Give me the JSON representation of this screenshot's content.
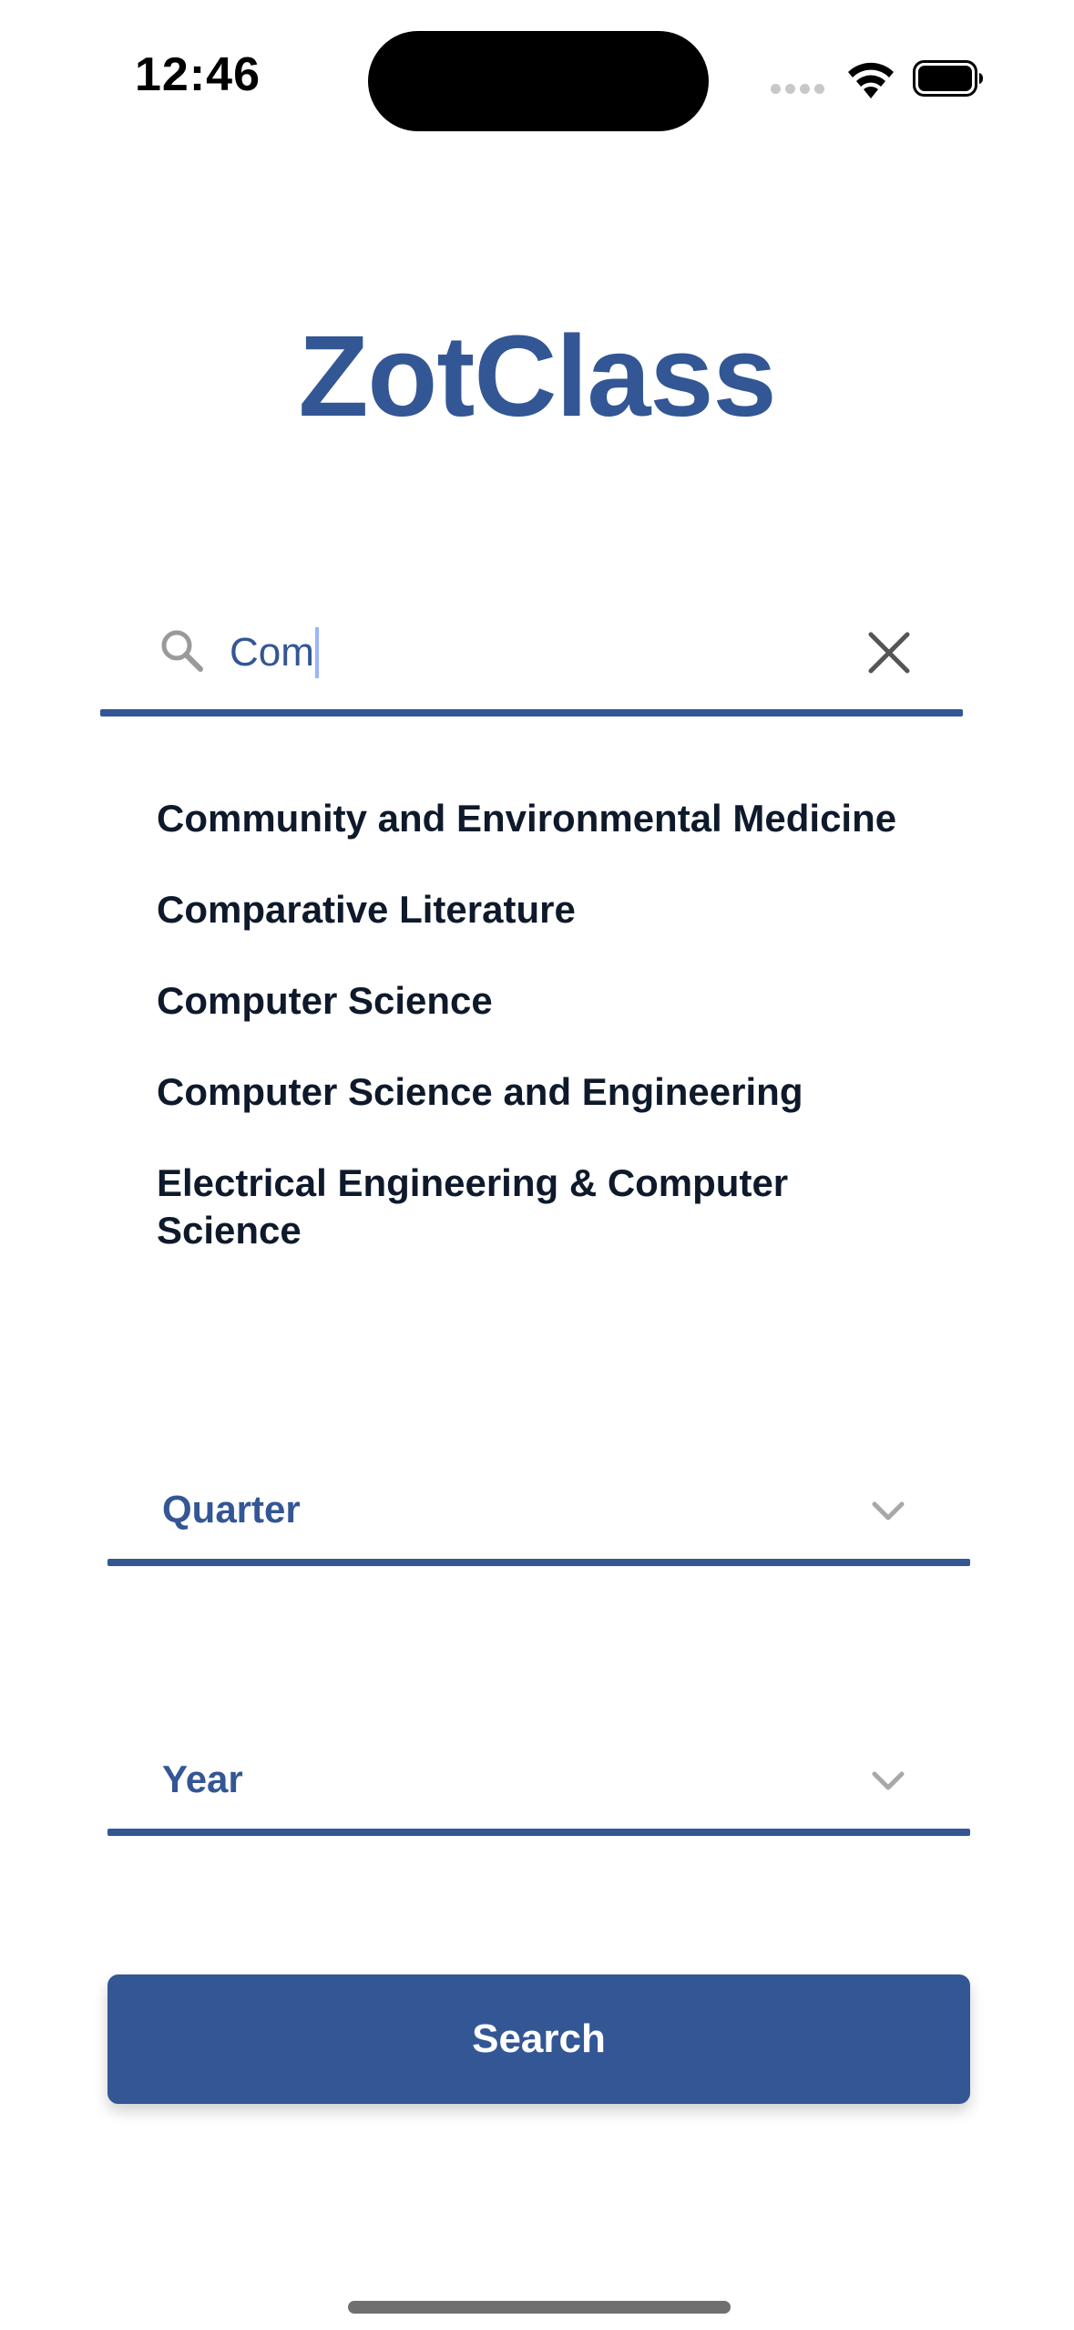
{
  "status_bar": {
    "time": "12:46",
    "icons": [
      "cellular-signal-icon",
      "wifi-icon",
      "battery-icon"
    ]
  },
  "app": {
    "title": "ZotClass"
  },
  "search": {
    "value": "Com",
    "icon": "search-icon",
    "clear_icon": "close-icon"
  },
  "suggestions": [
    "Community and Environmental Medicine",
    "Comparative Literature",
    "Computer Science",
    "Computer Science and Engineering",
    "Electrical Engineering & Computer Science"
  ],
  "quarter": {
    "label": "Quarter",
    "icon": "chevron-down-icon"
  },
  "year": {
    "label": "Year",
    "icon": "chevron-down-icon"
  },
  "search_button": {
    "label": "Search"
  },
  "colors": {
    "brand": "#335695",
    "suggestion_text": "#0e1a2b",
    "caret": "#9bb4ff"
  }
}
